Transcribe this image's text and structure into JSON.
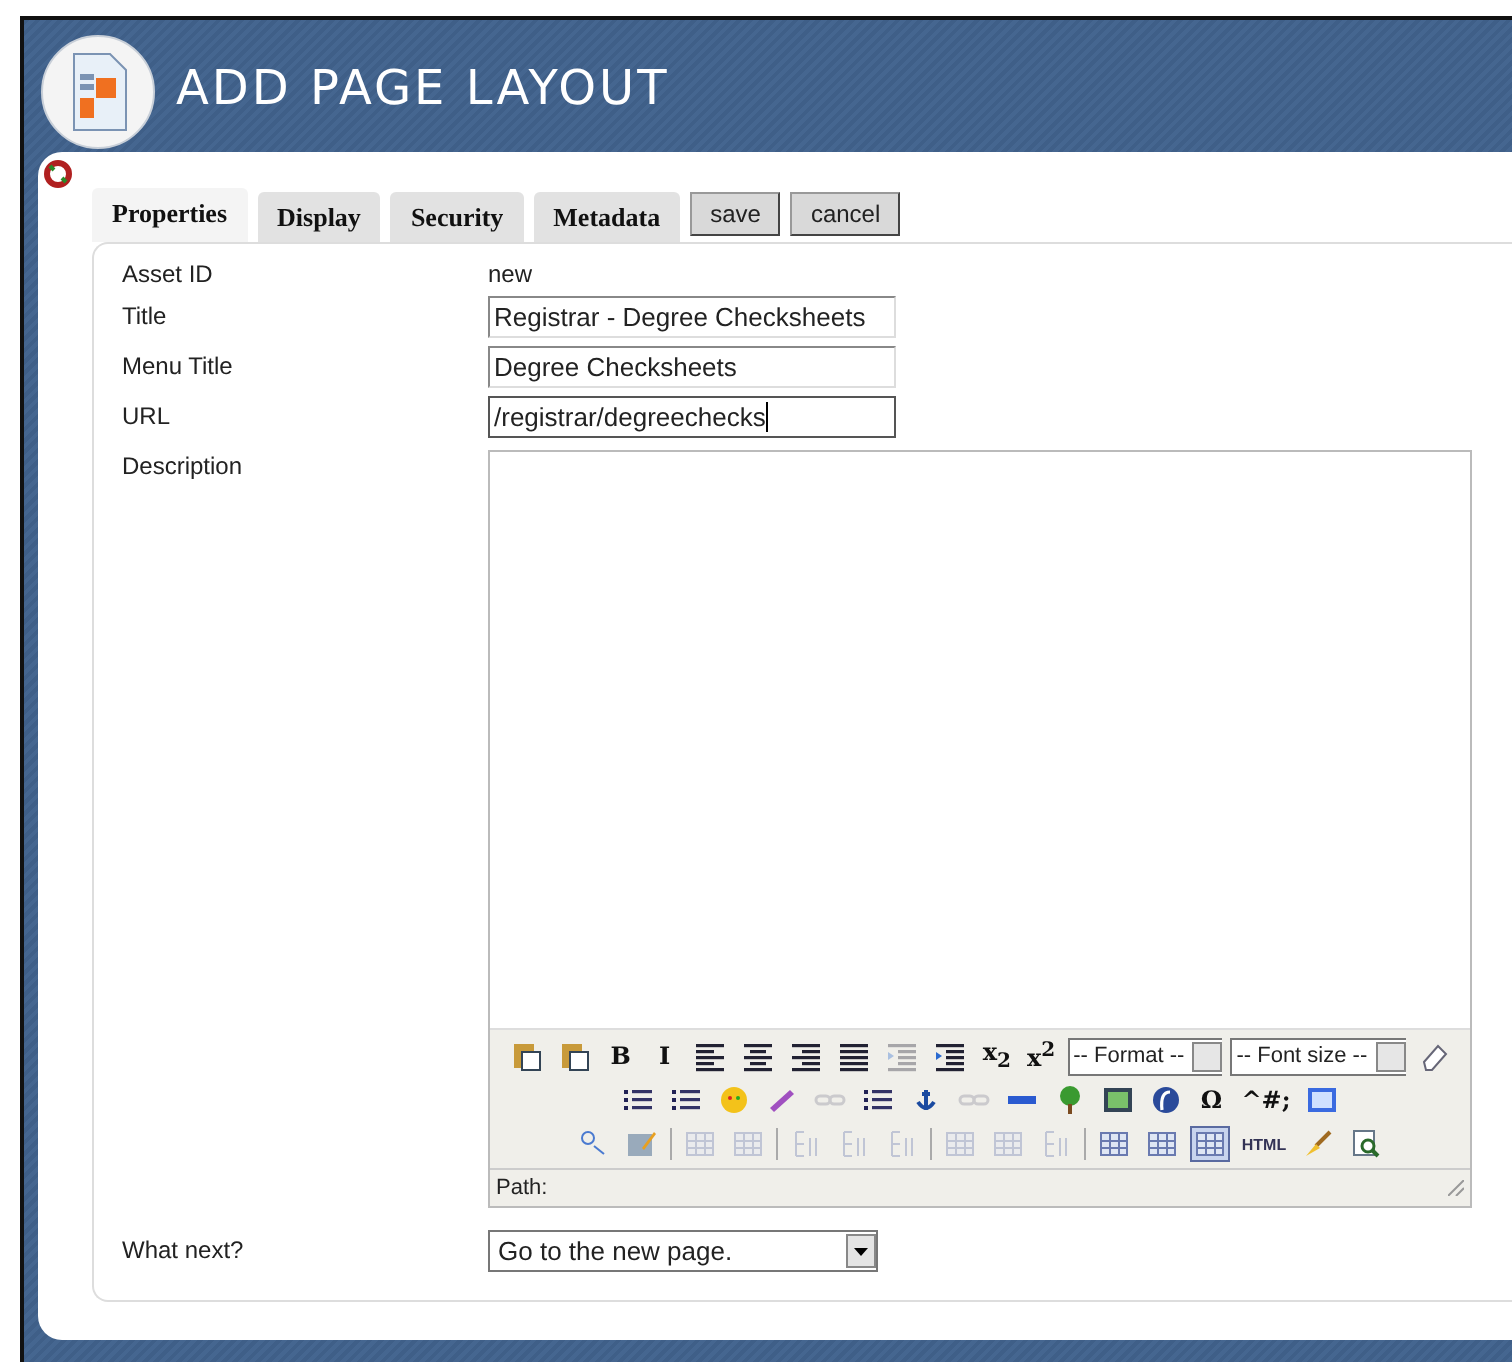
{
  "header": {
    "title": "ADD PAGE LAYOUT"
  },
  "tabs": [
    {
      "label": "Properties",
      "selected": true
    },
    {
      "label": "Display",
      "selected": false
    },
    {
      "label": "Security",
      "selected": false
    },
    {
      "label": "Metadata",
      "selected": false
    }
  ],
  "actions": [
    {
      "label": "save"
    },
    {
      "label": "cancel"
    }
  ],
  "fields": [
    {
      "kind": "static",
      "label": "Asset ID",
      "value": "new"
    },
    {
      "kind": "text",
      "label": "Title",
      "value": "Registrar - Degree Checksheets",
      "focused": false
    },
    {
      "kind": "text",
      "label": "Menu Title",
      "value": "Degree Checksheets",
      "focused": false
    },
    {
      "kind": "text",
      "label": "URL",
      "value": "/registrar/degreechecks",
      "focused": true
    },
    {
      "kind": "editor",
      "label": "Description",
      "path_label": "Path:"
    },
    {
      "kind": "select",
      "label": "What next?",
      "value": "Go to the new page."
    }
  ],
  "toolbar": [
    [
      {
        "kind": "icon",
        "disabled": false,
        "active": false
      },
      {
        "kind": "icon",
        "disabled": false,
        "active": false
      },
      {
        "kind": "glyph",
        "text": "B",
        "disabled": false,
        "active": false
      },
      {
        "kind": "glyph",
        "text": "I",
        "disabled": false,
        "active": false
      },
      {
        "kind": "icon",
        "disabled": false,
        "active": false
      },
      {
        "kind": "icon",
        "disabled": false,
        "active": false
      },
      {
        "kind": "icon",
        "disabled": false,
        "active": false
      },
      {
        "kind": "icon",
        "disabled": false,
        "active": false
      },
      {
        "kind": "icon",
        "disabled": true,
        "active": false
      },
      {
        "kind": "icon",
        "disabled": false,
        "active": false
      },
      {
        "kind": "glyph",
        "text": "x$_{2}$",
        "disabled": false,
        "active": false
      },
      {
        "kind": "glyph",
        "text": "x$^{2}$",
        "disabled": false,
        "active": false
      },
      {
        "kind": "select",
        "placeholder": "-- Format --"
      },
      {
        "kind": "select",
        "placeholder": "-- Font size --"
      },
      {
        "kind": "icon",
        "disabled": false,
        "active": false
      }
    ],
    [
      {
        "kind": "icon",
        "disabled": false,
        "active": false
      },
      {
        "kind": "icon",
        "disabled": false,
        "active": false
      },
      {
        "kind": "icon",
        "disabled": false,
        "active": false
      },
      {
        "kind": "icon",
        "disabled": false,
        "active": false
      },
      {
        "kind": "icon",
        "disabled": true,
        "active": false
      },
      {
        "kind": "icon",
        "disabled": false,
        "active": false
      },
      {
        "kind": "icon",
        "disabled": false,
        "active": false
      },
      {
        "kind": "icon",
        "disabled": true,
        "active": false
      },
      {
        "kind": "icon",
        "disabled": false,
        "active": false
      },
      {
        "kind": "icon",
        "disabled": false,
        "active": false
      },
      {
        "kind": "icon",
        "disabled": false,
        "active": false
      },
      {
        "kind": "icon",
        "disabled": false,
        "active": false
      },
      {
        "kind": "glyph",
        "text": "Ω",
        "disabled": false,
        "active": false
      },
      {
        "kind": "glyph",
        "text": "^#;",
        "disabled": false,
        "active": false
      },
      {
        "kind": "icon",
        "disabled": false,
        "active": false
      }
    ],
    [
      {
        "kind": "icon",
        "disabled": false,
        "active": false
      },
      {
        "kind": "icon",
        "disabled": false,
        "active": false
      },
      {
        "kind": "separator"
      },
      {
        "kind": "icon",
        "disabled": true,
        "active": false
      },
      {
        "kind": "icon",
        "disabled": true,
        "active": false
      },
      {
        "kind": "separator"
      },
      {
        "kind": "icon",
        "disabled": true,
        "active": false
      },
      {
        "kind": "icon",
        "disabled": true,
        "active": false
      },
      {
        "kind": "icon",
        "disabled": true,
        "active": false
      },
      {
        "kind": "separator"
      },
      {
        "kind": "icon",
        "disabled": true,
        "active": false
      },
      {
        "kind": "icon",
        "disabled": true,
        "active": false
      },
      {
        "kind": "icon",
        "disabled": true,
        "active": false
      },
      {
        "kind": "separator"
      },
      {
        "kind": "icon",
        "disabled": false,
        "active": false
      },
      {
        "kind": "icon",
        "disabled": false,
        "active": false
      },
      {
        "kind": "icon",
        "disabled": false,
        "active": true
      },
      {
        "kind": "glyph",
        "text": "HTML",
        "disabled": false,
        "active": false
      },
      {
        "kind": "icon",
        "disabled": false,
        "active": false
      },
      {
        "kind": "icon",
        "disabled": false,
        "active": false
      }
    ]
  ]
}
